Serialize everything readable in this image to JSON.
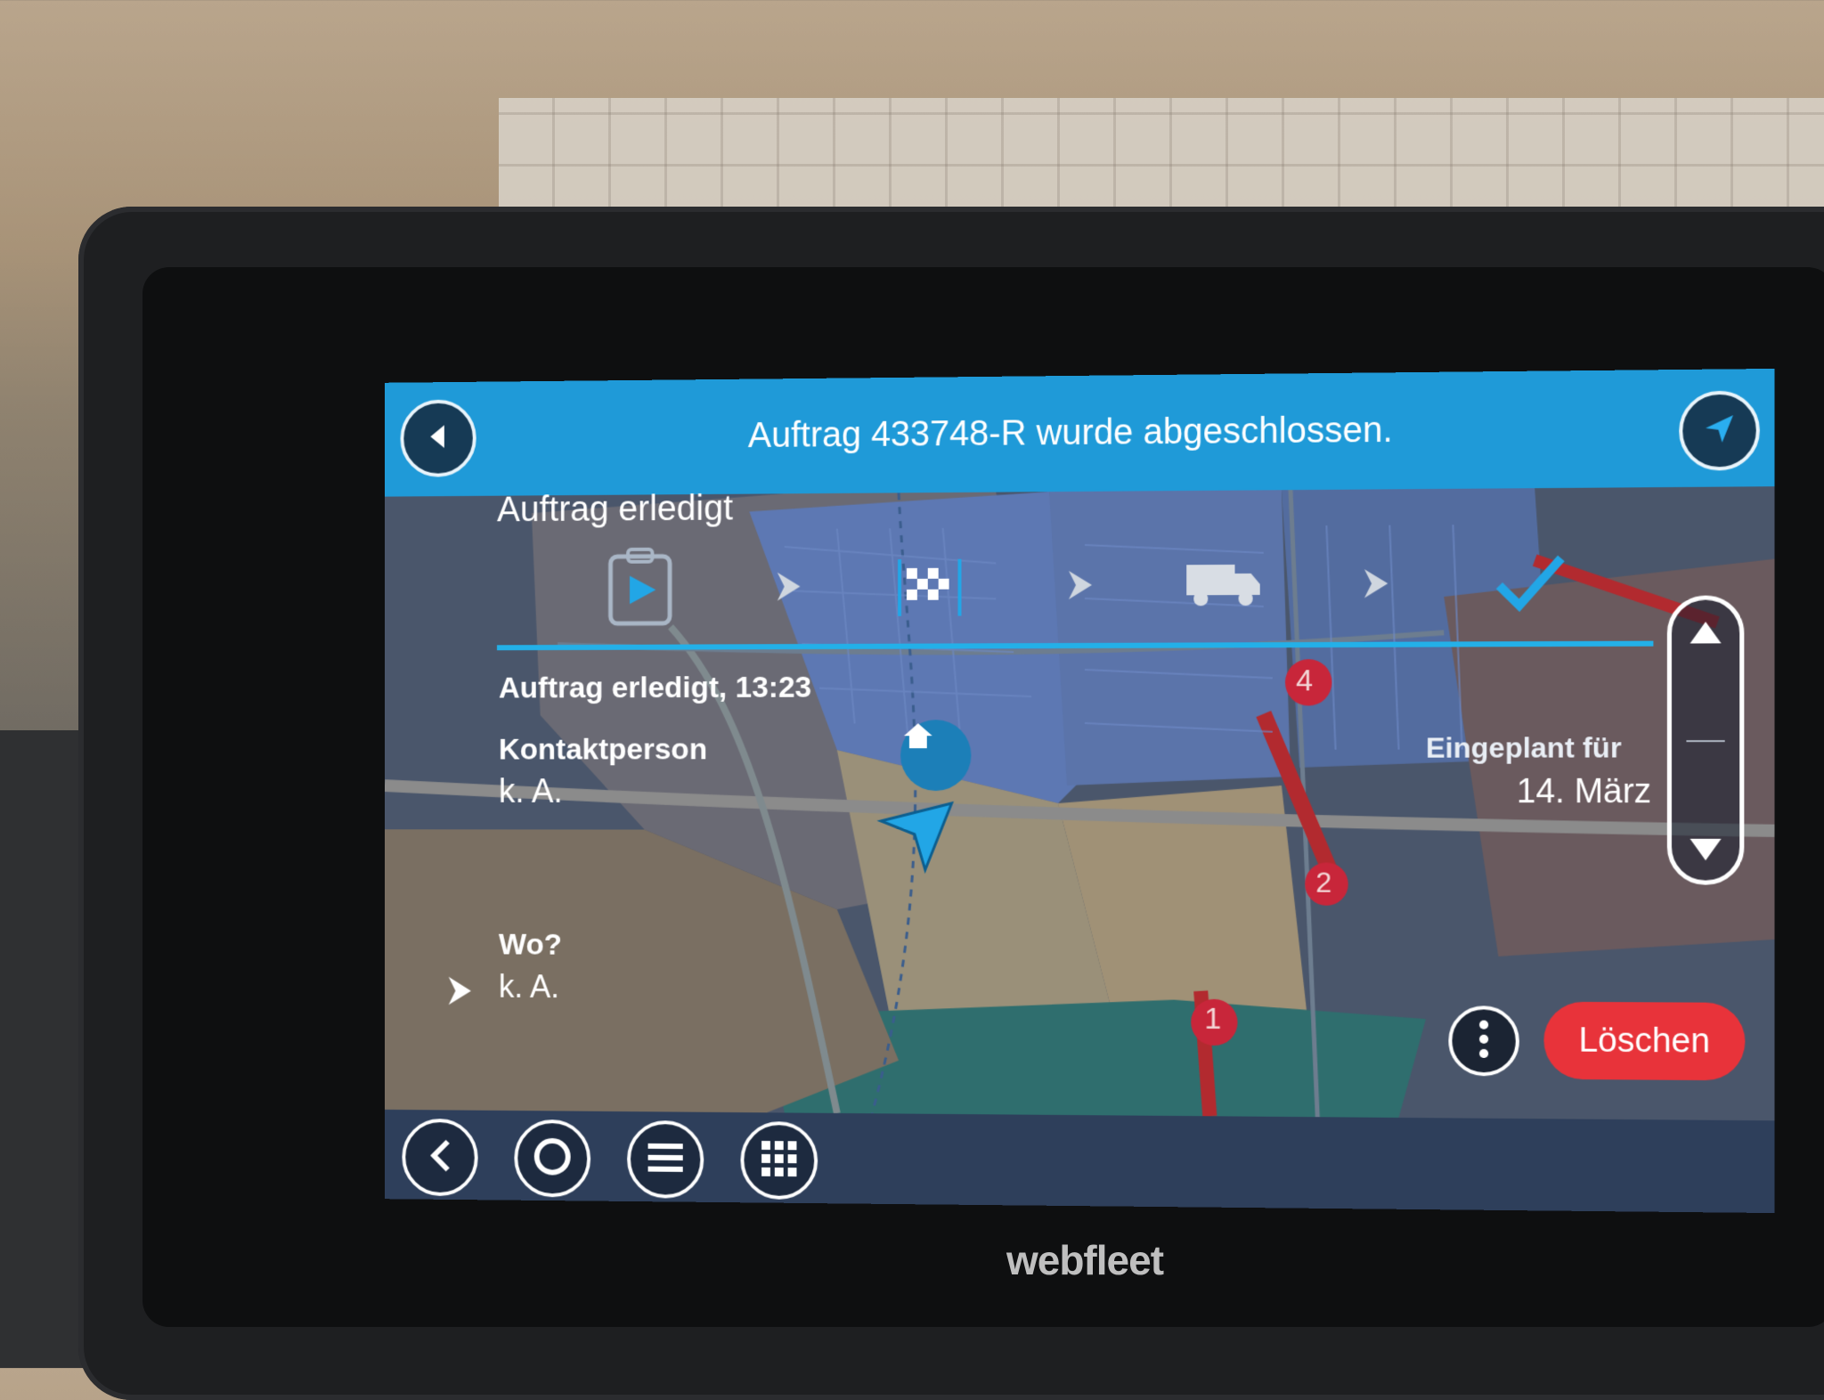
{
  "header": {
    "title": "Auftrag 433748-R wurde abgeschlossen."
  },
  "panel": {
    "title": "Auftrag erledigt",
    "status_text": "Auftrag erledigt, 13:23",
    "contact_label": "Kontaktperson",
    "contact_value": "k. A.",
    "where_label": "Wo?",
    "where_value": "k. A.",
    "scheduled_label": "Eingeplant für",
    "scheduled_value": "14. März"
  },
  "actions": {
    "delete_label": "Löschen"
  },
  "map_markers": [
    "4",
    "2",
    "1"
  ],
  "brand": "webfleet",
  "colors": {
    "accent": "#1f9ad8",
    "danger": "#e8333a",
    "progress": "#23b0e8"
  },
  "icons": [
    "back-icon",
    "navigate-icon",
    "clipboard-play-icon",
    "arrow-right-icon",
    "finish-flag-icon",
    "truck-icon",
    "checkmark-icon",
    "scroll-up-icon",
    "scroll-down-icon",
    "more-icon",
    "home-icon",
    "position-arrow-icon",
    "circle-icon",
    "menu-icon",
    "grid-icon"
  ]
}
